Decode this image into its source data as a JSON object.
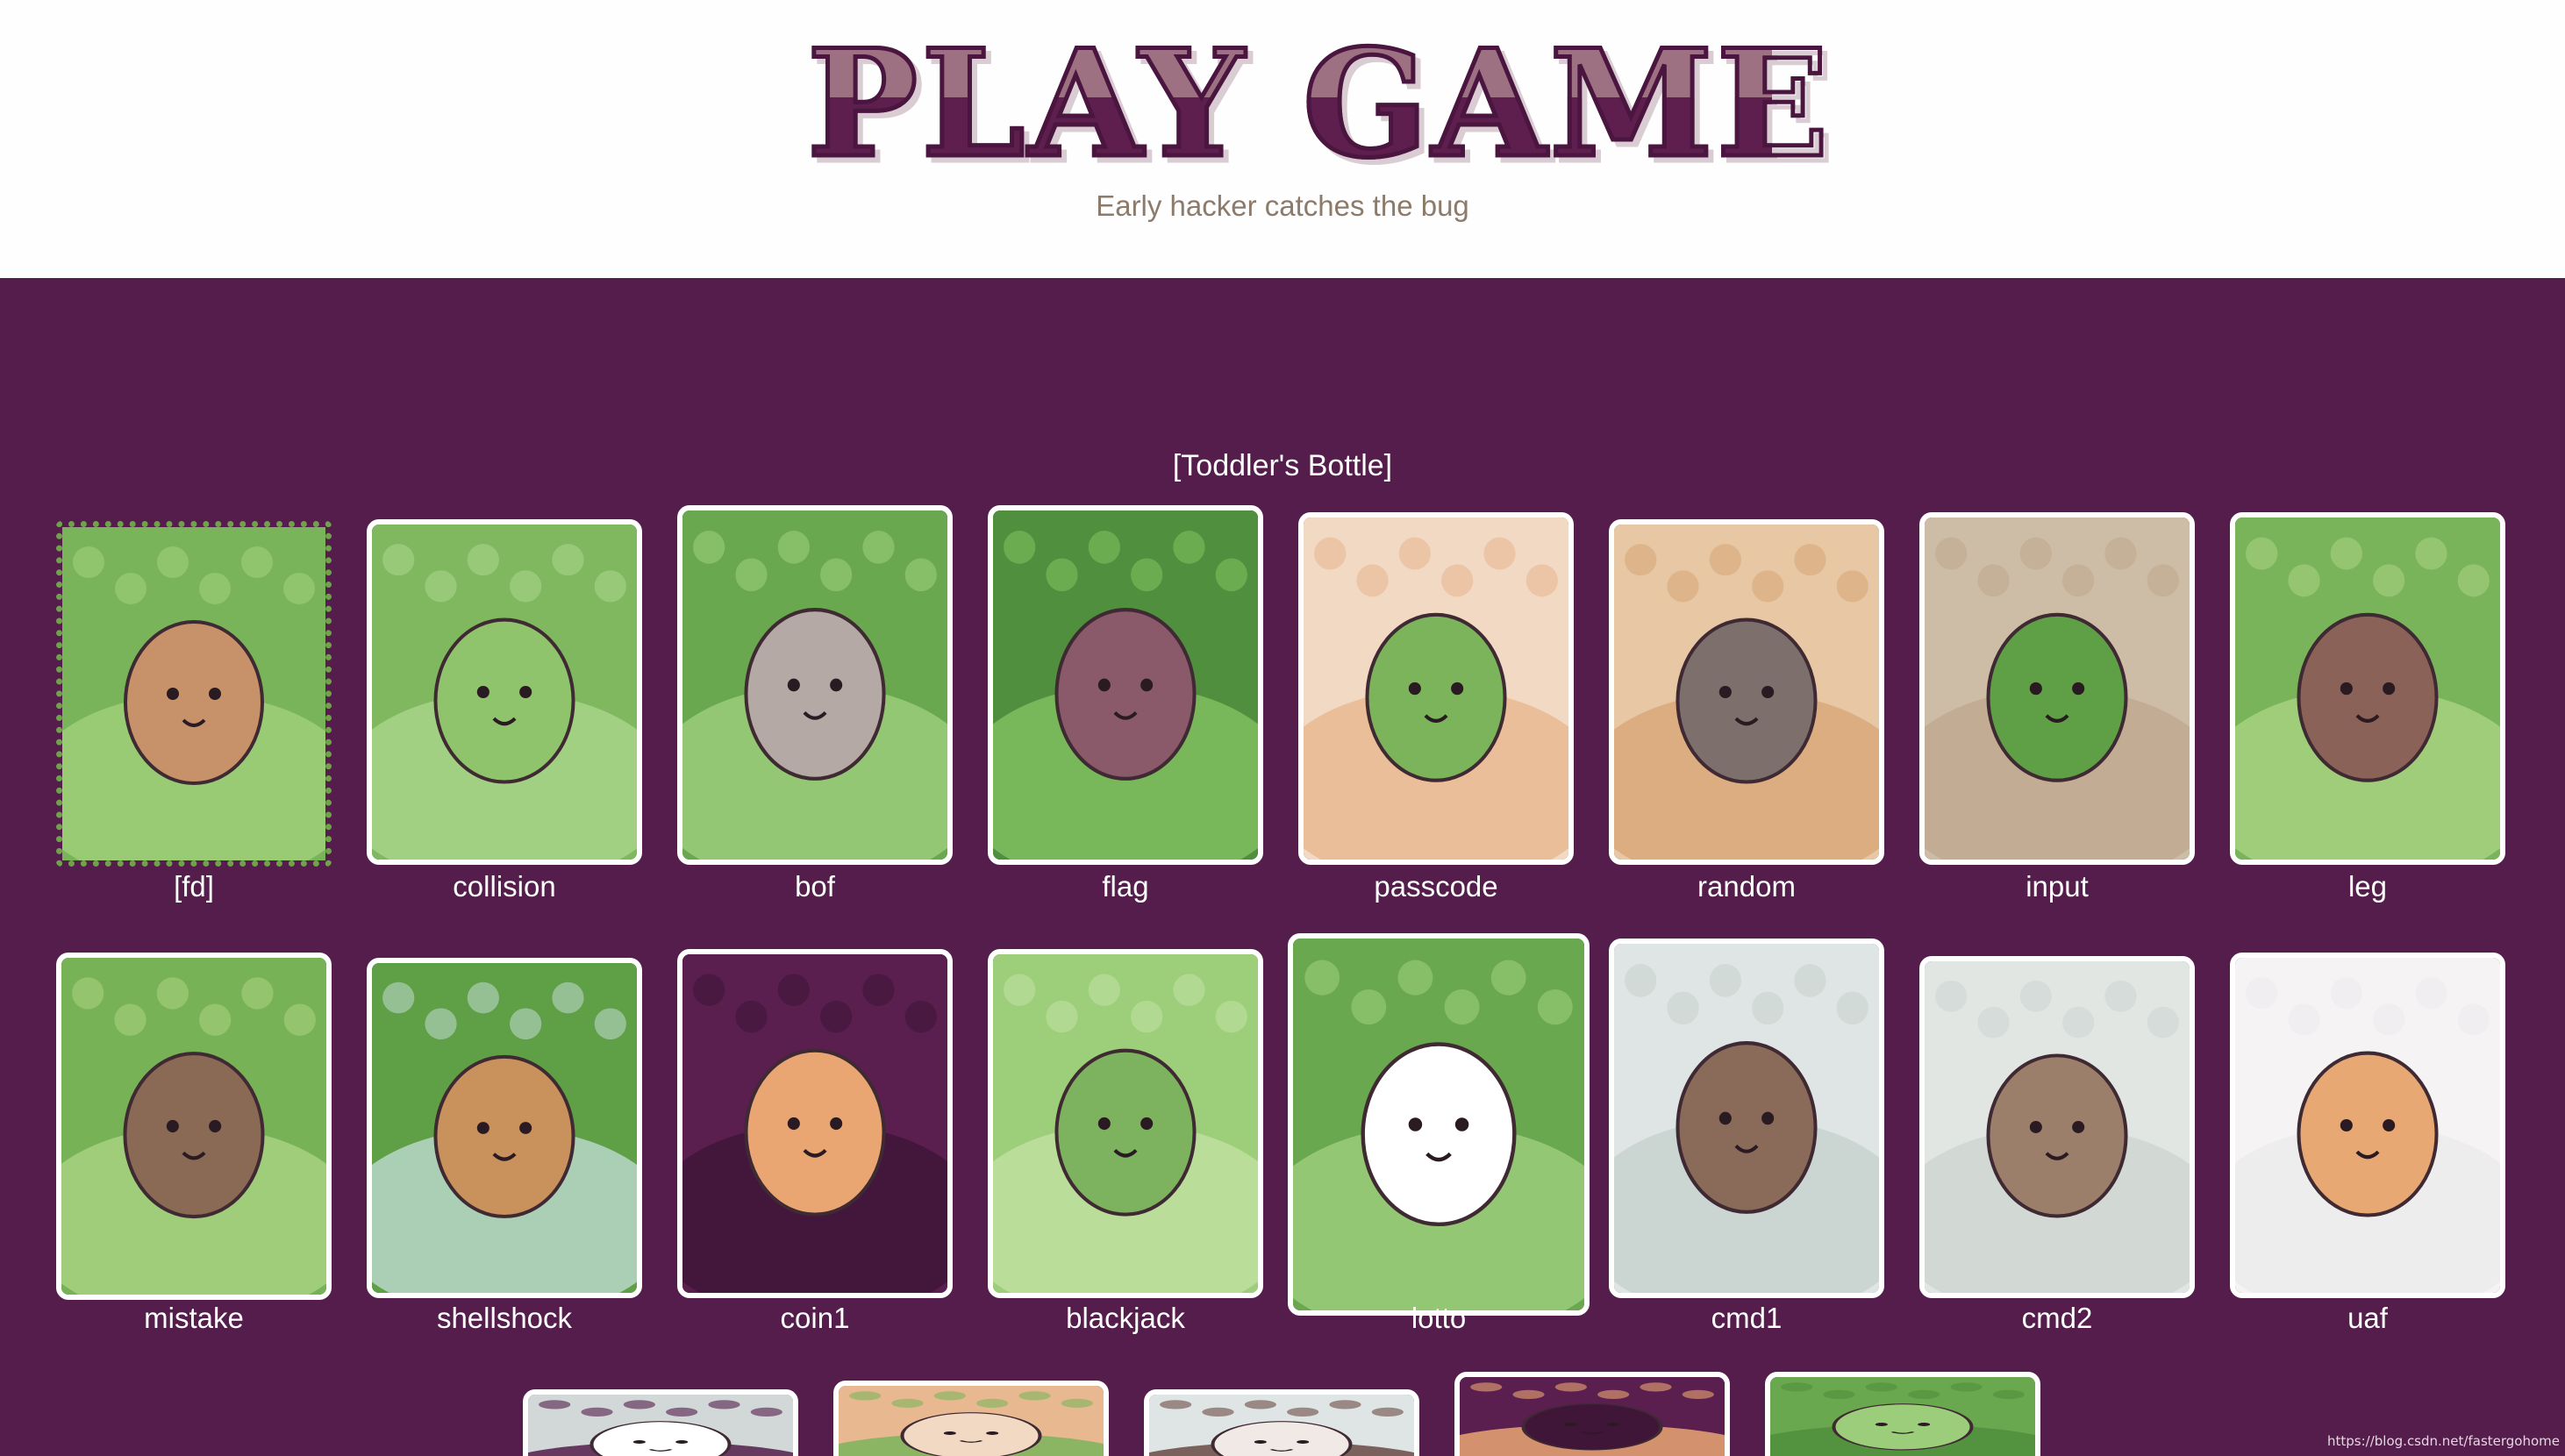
{
  "header": {
    "logo_text": "PLAY GAME",
    "subtitle": "Early hacker catches the bug"
  },
  "section": {
    "title": "[Toddler's Bottle]"
  },
  "challenges": [
    {
      "name": "[fd]",
      "selected": true,
      "palette": [
        "#7ab45a",
        "#9fcf7a",
        "#c7926a"
      ]
    },
    {
      "name": "collision",
      "palette": [
        "#7fb85f",
        "#a8d48a",
        "#8fc46c"
      ]
    },
    {
      "name": "bof",
      "palette": [
        "#6aa84f",
        "#9bcd7a",
        "#b4a9a5"
      ]
    },
    {
      "name": "flag",
      "palette": [
        "#4f8f3d",
        "#7fbf5f",
        "#8a5a6a"
      ]
    },
    {
      "name": "passcode",
      "palette": [
        "#f1d9c4",
        "#e8b891",
        "#7bb45a"
      ]
    },
    {
      "name": "random",
      "palette": [
        "#e7c7a4",
        "#d9a87a",
        "#7d6f6c"
      ]
    },
    {
      "name": "input",
      "palette": [
        "#cdbda6",
        "#bfa98f",
        "#5f9f45"
      ]
    },
    {
      "name": "leg",
      "palette": [
        "#7ab45a",
        "#a6d17f",
        "#8a6258"
      ]
    },
    {
      "name": "mistake",
      "palette": [
        "#78b256",
        "#a6d17f",
        "#8a6a55"
      ]
    },
    {
      "name": "shellshock",
      "palette": [
        "#5f9f45",
        "#b9d7c8",
        "#c9915c"
      ]
    },
    {
      "name": "coin1",
      "palette": [
        "#5a1e4f",
        "#3f1538",
        "#e9a673"
      ]
    },
    {
      "name": "blackjack",
      "palette": [
        "#9dcf7a",
        "#bfe0a0",
        "#7db35f"
      ]
    },
    {
      "name": "lotto",
      "palette": [
        "#6aa84f",
        "#9bcd7a",
        "#ffffff"
      ]
    },
    {
      "name": "cmd1",
      "palette": [
        "#dfe5e4",
        "#c8d2cf",
        "#8a6a58"
      ]
    },
    {
      "name": "cmd2",
      "palette": [
        "#e2e6e3",
        "#cfd6d2",
        "#9c7f6a"
      ]
    },
    {
      "name": "uaf",
      "palette": [
        "#f5f3f4",
        "#ecebec",
        "#e8a874"
      ]
    },
    {
      "name": "",
      "palette": [
        "#d2d8d7",
        "#541d4b",
        "#ffffff"
      ]
    },
    {
      "name": "",
      "palette": [
        "#e8b891",
        "#7bb45a",
        "#f1d9c4"
      ]
    },
    {
      "name": "",
      "palette": [
        "#dfe5e4",
        "#6a4a44",
        "#f1e9e5"
      ]
    },
    {
      "name": "",
      "palette": [
        "#5a1e4f",
        "#e9a673",
        "#3f1538"
      ]
    },
    {
      "name": "",
      "palette": [
        "#6aa84f",
        "#4f8f3d",
        "#9bcd7a"
      ]
    }
  ],
  "watermark": "https://blog.csdn.net/fastergohome"
}
